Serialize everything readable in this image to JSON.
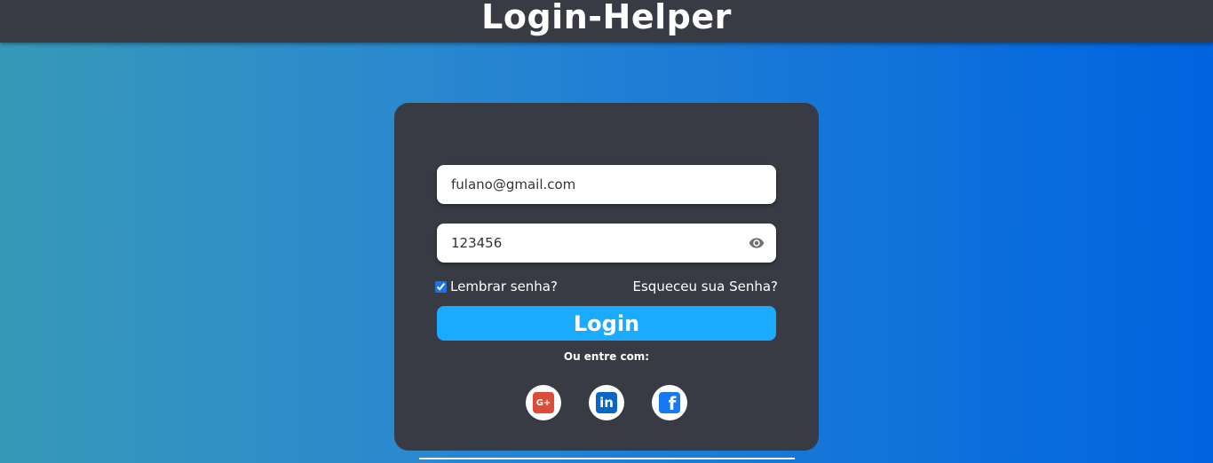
{
  "header": {
    "title": "Login-Helper"
  },
  "form": {
    "email_value": "fulano@gmail.com",
    "password_value": "123456",
    "remember_label": "Lembrar senha?",
    "remember_checked": true,
    "forgot_label": "Esqueceu sua Senha?",
    "login_label": "Login",
    "alt_login_text": "Ou entre com:"
  },
  "social": [
    {
      "name": "google",
      "icon": "google-plus-icon",
      "glyph": "G+"
    },
    {
      "name": "linkedin",
      "icon": "linkedin-icon",
      "glyph": "in"
    },
    {
      "name": "facebook",
      "icon": "facebook-icon",
      "glyph": "f"
    }
  ],
  "colors": {
    "header_bg": "#383b44",
    "card_bg": "#383b44",
    "accent": "#1aabff",
    "background_start": "#3799b8",
    "background_end": "#0064e0"
  }
}
